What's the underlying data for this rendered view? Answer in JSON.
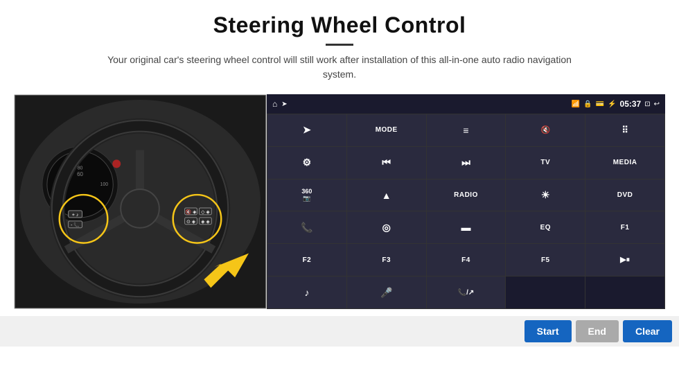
{
  "header": {
    "title": "Steering Wheel Control",
    "subtitle": "Your original car's steering wheel control will still work after installation of this all-in-one auto radio navigation system."
  },
  "status_bar": {
    "time": "05:37",
    "icons": [
      "home",
      "wifi",
      "lock",
      "sd",
      "bluetooth",
      "screenshot",
      "back"
    ]
  },
  "buttons": [
    {
      "id": "r1c1",
      "icon": "➤",
      "label": "",
      "type": "icon"
    },
    {
      "id": "r1c2",
      "icon": "",
      "label": "MODE",
      "type": "text"
    },
    {
      "id": "r1c3",
      "icon": "≡",
      "label": "",
      "type": "icon"
    },
    {
      "id": "r1c4",
      "icon": "🔇",
      "label": "",
      "type": "icon"
    },
    {
      "id": "r1c5",
      "icon": "⠿",
      "label": "",
      "type": "icon"
    },
    {
      "id": "r2c1",
      "icon": "⚙",
      "label": "",
      "type": "icon"
    },
    {
      "id": "r2c2",
      "icon": "⏮",
      "label": "",
      "type": "icon"
    },
    {
      "id": "r2c3",
      "icon": "⏭",
      "label": "",
      "type": "icon"
    },
    {
      "id": "r2c4",
      "icon": "",
      "label": "TV",
      "type": "text"
    },
    {
      "id": "r2c5",
      "icon": "",
      "label": "MEDIA",
      "type": "text"
    },
    {
      "id": "r3c1",
      "icon": "360",
      "label": "",
      "type": "icon"
    },
    {
      "id": "r3c2",
      "icon": "▲",
      "label": "",
      "type": "icon"
    },
    {
      "id": "r3c3",
      "icon": "",
      "label": "RADIO",
      "type": "text"
    },
    {
      "id": "r3c4",
      "icon": "☀",
      "label": "",
      "type": "icon"
    },
    {
      "id": "r3c5",
      "icon": "",
      "label": "DVD",
      "type": "text"
    },
    {
      "id": "r4c1",
      "icon": "📞",
      "label": "",
      "type": "icon"
    },
    {
      "id": "r4c2",
      "icon": "◎",
      "label": "",
      "type": "icon"
    },
    {
      "id": "r4c3",
      "icon": "▬",
      "label": "",
      "type": "icon"
    },
    {
      "id": "r4c4",
      "icon": "",
      "label": "EQ",
      "type": "text"
    },
    {
      "id": "r4c5",
      "icon": "",
      "label": "F1",
      "type": "text"
    },
    {
      "id": "r5c1",
      "icon": "",
      "label": "F2",
      "type": "text"
    },
    {
      "id": "r5c2",
      "icon": "",
      "label": "F3",
      "type": "text"
    },
    {
      "id": "r5c3",
      "icon": "",
      "label": "F4",
      "type": "text"
    },
    {
      "id": "r5c4",
      "icon": "",
      "label": "F5",
      "type": "text"
    },
    {
      "id": "r5c5",
      "icon": "▶⏸",
      "label": "",
      "type": "icon"
    },
    {
      "id": "r6c1",
      "icon": "♪",
      "label": "",
      "type": "icon"
    },
    {
      "id": "r6c2",
      "icon": "🎤",
      "label": "",
      "type": "icon"
    },
    {
      "id": "r6c3",
      "icon": "📞↗",
      "label": "",
      "type": "icon"
    },
    {
      "id": "r6c4",
      "icon": "",
      "label": "",
      "type": "empty"
    },
    {
      "id": "r6c5",
      "icon": "",
      "label": "",
      "type": "empty"
    }
  ],
  "bottom_bar": {
    "start_label": "Start",
    "end_label": "End",
    "clear_label": "Clear"
  }
}
